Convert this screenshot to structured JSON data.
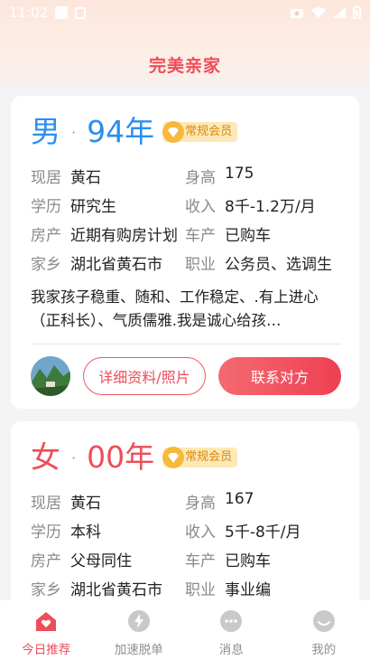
{
  "status_bar": {
    "time": "11:02"
  },
  "header": {
    "title": "完美亲家"
  },
  "profiles": [
    {
      "gender": "男",
      "year": "94年",
      "badge": "常规会员",
      "fields": [
        [
          {
            "label": "现居",
            "value": "黄石"
          },
          {
            "label": "身高",
            "value": "175"
          }
        ],
        [
          {
            "label": "学历",
            "value": "研究生"
          },
          {
            "label": "收入",
            "value": "8千-1.2万/月"
          }
        ],
        [
          {
            "label": "房产",
            "value": "近期有购房计划"
          },
          {
            "label": "车产",
            "value": "已购车"
          }
        ],
        [
          {
            "label": "家乡",
            "value": "湖北省黄石市"
          },
          {
            "label": "职业",
            "value": "公务员、选调生"
          }
        ]
      ],
      "intro": "我家孩子稳重、随和、工作稳定、.有上进心（正科长）、气质儒雅.我是诚心给孩…",
      "detail_button": "详细资料/照片",
      "contact_button": "联系对方",
      "accent": "#2b8ef0"
    },
    {
      "gender": "女",
      "year": "00年",
      "badge": "常规会员",
      "fields": [
        [
          {
            "label": "现居",
            "value": "黄石"
          },
          {
            "label": "身高",
            "value": "167"
          }
        ],
        [
          {
            "label": "学历",
            "value": "本科"
          },
          {
            "label": "收入",
            "value": "5千-8千/月"
          }
        ],
        [
          {
            "label": "房产",
            "value": "父母同住"
          },
          {
            "label": "车产",
            "value": "已购车"
          }
        ],
        [
          {
            "label": "家乡",
            "value": "湖北省黄石市"
          },
          {
            "label": "职业",
            "value": "事业编"
          }
        ]
      ],
      "accent": "#ee4d5a"
    }
  ],
  "tabbar": {
    "items": [
      {
        "label": "今日推荐",
        "icon": "home-heart-icon",
        "active": true
      },
      {
        "label": "加速脱单",
        "icon": "lightning-icon",
        "active": false
      },
      {
        "label": "消息",
        "icon": "chat-icon",
        "active": false
      },
      {
        "label": "我的",
        "icon": "profile-face-icon",
        "active": false
      }
    ]
  },
  "colors": {
    "brand": "#ee4d5a",
    "badge_bg": "#fde8b8",
    "badge_text": "#d98a0c"
  }
}
